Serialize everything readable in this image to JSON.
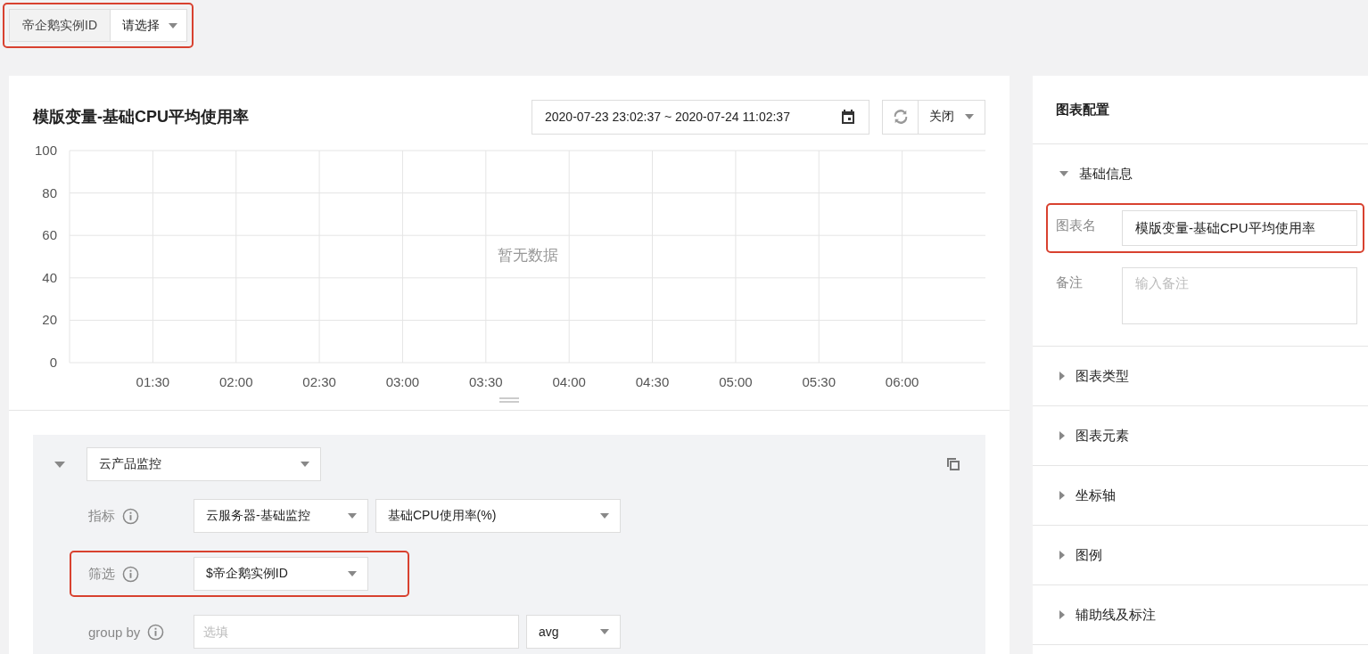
{
  "variable_bar": {
    "label": "帝企鹅实例ID",
    "value": "请选择",
    "highlighted": true
  },
  "chart_panel": {
    "title": "模版变量-基础CPU平均使用率",
    "time_range": "2020-07-23 23:02:37 ~ 2020-07-24 11:02:37",
    "refresh_interval": "关闭",
    "chart": {
      "y_ticks": [
        "100",
        "80",
        "60",
        "40",
        "20",
        "0"
      ],
      "x_labels": [
        "01:30",
        "02:00",
        "02:30",
        "03:00",
        "03:30",
        "04:00",
        "04:30",
        "05:00",
        "05:30",
        "06:00"
      ],
      "empty_text": "暂无数据"
    }
  },
  "query": {
    "expanded": true,
    "source": "云产品监控",
    "rows": [
      {
        "kind": "select",
        "label": "指标",
        "selects": [
          "云服务器-基础监控",
          "基础CPU使用率(%)"
        ],
        "highlighted": false
      },
      {
        "kind": "select",
        "label": "筛选",
        "selects": [
          "$帝企鹅实例ID"
        ],
        "highlighted": true
      },
      {
        "kind": "input",
        "label": "group by",
        "placeholder": "选填",
        "aggregate": "avg",
        "highlighted": false
      }
    ]
  },
  "config_panel": {
    "title": "图表配置",
    "sections": [
      {
        "label": "基础信息",
        "expanded": true,
        "fields": [
          {
            "kind": "text",
            "label": "图表名",
            "value": "模版变量-基础CPU平均使用率",
            "highlighted": true
          },
          {
            "kind": "textarea",
            "label": "备注",
            "placeholder": "输入备注",
            "highlighted": false
          }
        ]
      },
      {
        "label": "图表类型",
        "expanded": false
      },
      {
        "label": "图表元素",
        "expanded": false
      },
      {
        "label": "坐标轴",
        "expanded": false
      },
      {
        "label": "图例",
        "expanded": false
      },
      {
        "label": "辅助线及标注",
        "expanded": false
      }
    ]
  }
}
